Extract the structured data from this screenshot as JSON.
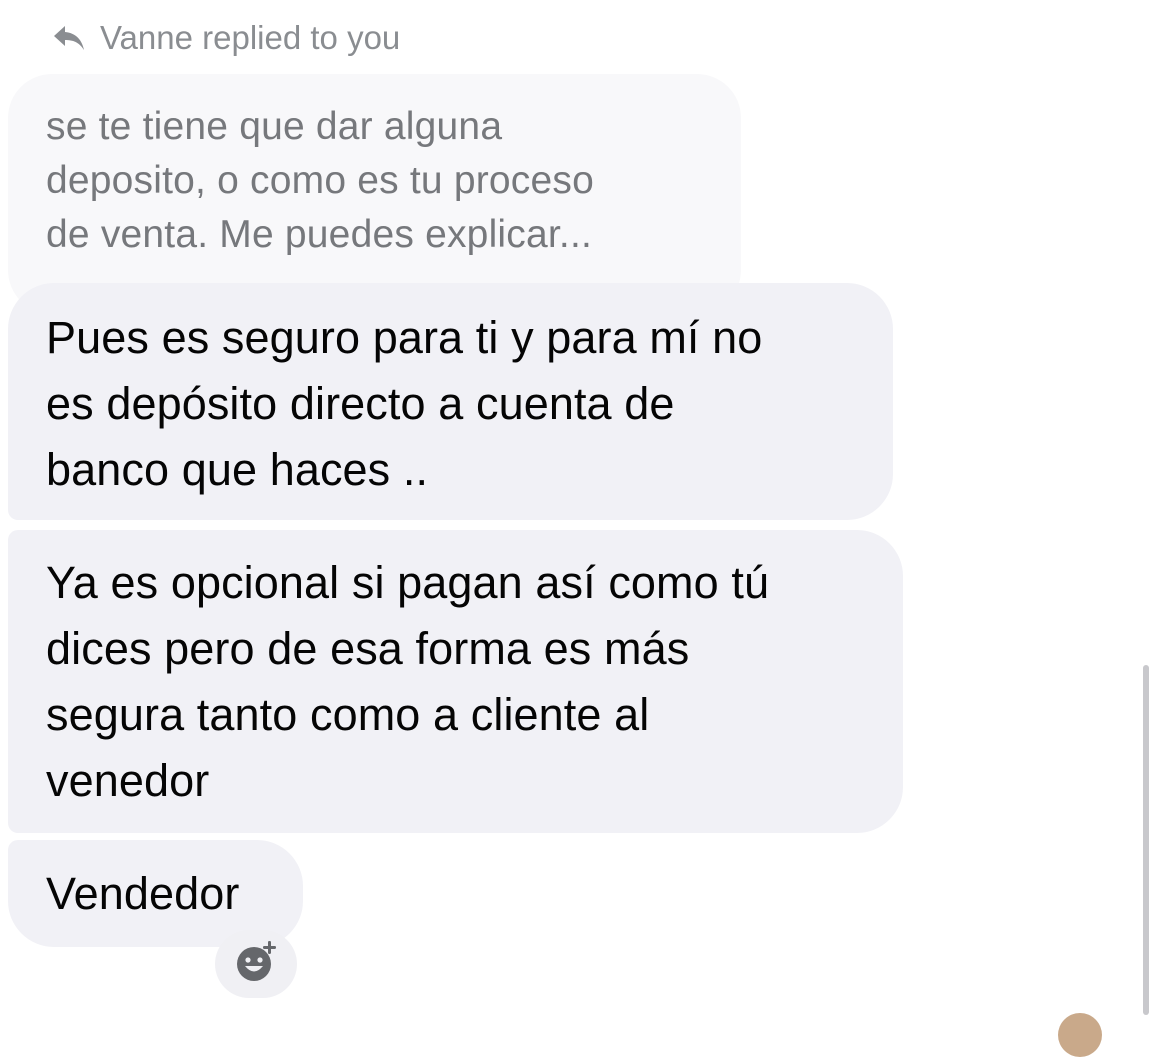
{
  "reply_header": {
    "icon": "reply-arrow-icon",
    "text": "Vanne replied to you"
  },
  "quoted_message": {
    "lines": [
      "se te tiene que dar alguna",
      "deposito, o como es tu proceso",
      "de venta. Me puedes explicar..."
    ]
  },
  "messages": [
    {
      "lines": [
        "Pues es seguro para ti y para mí no",
        "es depósito directo a cuenta de",
        "banco que haces .."
      ]
    },
    {
      "lines": [
        "Ya es opcional si pagan así como tú",
        "dices pero de esa forma es más",
        "segura tanto como a cliente al",
        "venedor"
      ]
    },
    {
      "lines": [
        "Vendedor"
      ]
    }
  ],
  "reaction_button": {
    "icon": "add-reaction-smiley-icon"
  },
  "colors": {
    "bubble_bg": "#f1f1f6",
    "quoted_bg": "#f8f8fa",
    "text": "#050505",
    "muted_text": "#8a8d91"
  }
}
